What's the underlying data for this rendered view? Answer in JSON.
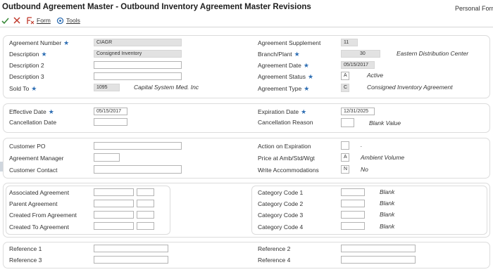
{
  "header": {
    "title": "Outbound Agreement Master - Outbound Inventory Agreement Master Revisions",
    "personal_form": "Personal Form"
  },
  "toolbar": {
    "form": "Form",
    "tools": "Tools"
  },
  "section1": {
    "agreement_number": {
      "label": "Agreement Number",
      "value": "CIAGR"
    },
    "description": {
      "label": "Description",
      "value": "Consigned Inventory"
    },
    "description2": {
      "label": "Description 2",
      "value": ""
    },
    "description3": {
      "label": "Description 3",
      "value": ""
    },
    "sold_to": {
      "label": "Sold To",
      "value": "1095",
      "desc": "Capital System Med. Inc"
    },
    "agreement_supplement": {
      "label": "Agreement Supplement",
      "value": "11"
    },
    "branch_plant": {
      "label": "Branch/Plant",
      "value": "30",
      "desc": "Eastern Distribution Center"
    },
    "agreement_date": {
      "label": "Agreement Date",
      "value": "05/15/2017"
    },
    "agreement_status": {
      "label": "Agreement Status",
      "value": "A",
      "desc": "Active"
    },
    "agreement_type": {
      "label": "Agreement Type",
      "value": "C",
      "desc": "Consigned Inventory Agreement"
    }
  },
  "section2": {
    "effective_date": {
      "label": "Effective Date",
      "value": "05/15/2017"
    },
    "cancellation_date": {
      "label": "Cancellation Date",
      "value": ""
    },
    "expiration_date": {
      "label": "Expiration Date",
      "value": "12/31/2025"
    },
    "cancellation_reason": {
      "label": "Cancellation Reason",
      "value": "",
      "desc": "Blank Value"
    }
  },
  "section3": {
    "customer_po": {
      "label": "Customer PO",
      "value": ""
    },
    "agreement_manager": {
      "label": "Agreement Manager",
      "value": ""
    },
    "customer_contact": {
      "label": "Customer Contact",
      "value": ""
    },
    "action_on_expiration": {
      "label": "Action on Expiration",
      "value": "",
      "desc": "."
    },
    "price_at": {
      "label": "Price at Amb/Std/Wgt",
      "value": "A",
      "desc": "Ambient Volume"
    },
    "write_accommodations": {
      "label": "Write Accommodations",
      "value": "N",
      "desc": "No"
    }
  },
  "section4": {
    "associated_agreement": {
      "label": "Associated Agreement"
    },
    "parent_agreement": {
      "label": "Parent Agreement"
    },
    "created_from_agreement": {
      "label": "Created From Agreement"
    },
    "created_to_agreement": {
      "label": "Created To Agreement"
    },
    "category_code_1": {
      "label": "Category Code 1",
      "desc": "Blank"
    },
    "category_code_2": {
      "label": "Category Code 2",
      "desc": "Blank"
    },
    "category_code_3": {
      "label": "Category Code 3",
      "desc": "Blank"
    },
    "category_code_4": {
      "label": "Category Code 4",
      "desc": "Blank"
    }
  },
  "section5": {
    "reference1": {
      "label": "Reference 1"
    },
    "reference2": {
      "label": "Reference 2"
    },
    "reference3": {
      "label": "Reference 3"
    },
    "reference4": {
      "label": "Reference 4"
    }
  }
}
